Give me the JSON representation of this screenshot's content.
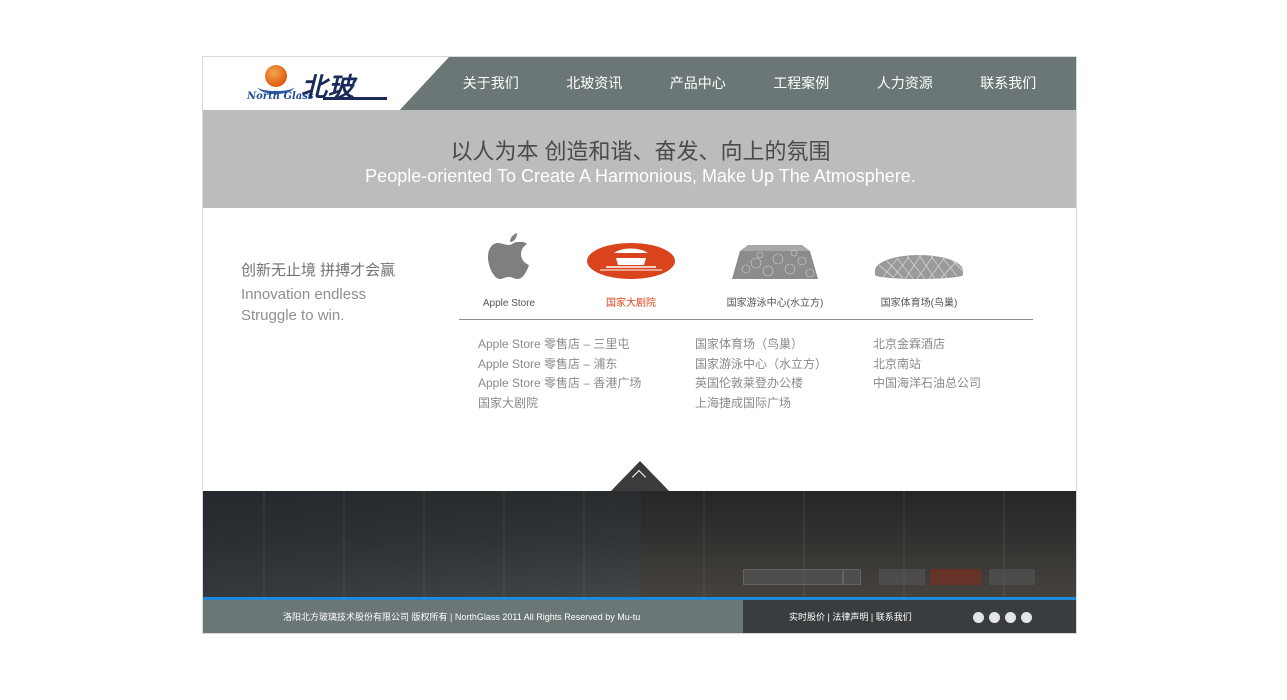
{
  "logo": {
    "en": "North Glass",
    "cn": "北玻"
  },
  "nav": {
    "items": [
      {
        "label": "关于我们"
      },
      {
        "label": "北玻资讯"
      },
      {
        "label": "产品中心"
      },
      {
        "label": "工程案例"
      },
      {
        "label": "人力资源"
      },
      {
        "label": "联系我们"
      }
    ]
  },
  "banner": {
    "title_cn": "以人为本 创造和谐、奋发、向上的氛围",
    "title_en": "People-oriented To Create A Harmonious, Make Up The Atmosphere."
  },
  "slogan": {
    "cn": "创新无止境 拼搏才会赢",
    "en_line1": "Innovation endless",
    "en_line2": "Struggle to win."
  },
  "brands": [
    {
      "label": "Apple Store",
      "icon": "apple-logo-icon"
    },
    {
      "label": "国家大剧院",
      "icon": "national-theater-logo-icon",
      "active": true
    },
    {
      "label": "国家游泳中心(水立方)",
      "icon": "water-cube-icon"
    },
    {
      "label": "国家体育场(鸟巢)",
      "icon": "birds-nest-icon"
    }
  ],
  "projects": {
    "col1": [
      "Apple Store 零售店 – 三里屯",
      "Apple Store 零售店 – 浦东",
      "Apple Store 零售店 – 香港广场",
      "国家大剧院"
    ],
    "col2": [
      "国家体育场（鸟巢）",
      "国家游泳中心（水立方）",
      "英国伦敦莱登办公楼",
      "上海捷成国际广场"
    ],
    "col3": [
      "北京金霖酒店",
      "北京南站",
      "中国海洋石油总公司"
    ]
  },
  "footer": {
    "copyright": "洛阳北方玻璃技术股份有限公司 版权所有   |   NorthGlass  2011 All Rights Reserved  by Mu-tu",
    "link1": "实时股价",
    "sep": " | ",
    "link2": "法律声明",
    "link3": "联系我们"
  },
  "colors": {
    "header_bg": "#6b7676",
    "banner_bg": "#bbbcbe",
    "accent_red": "#d9441c",
    "footer_blue": "#1b8ad8"
  }
}
